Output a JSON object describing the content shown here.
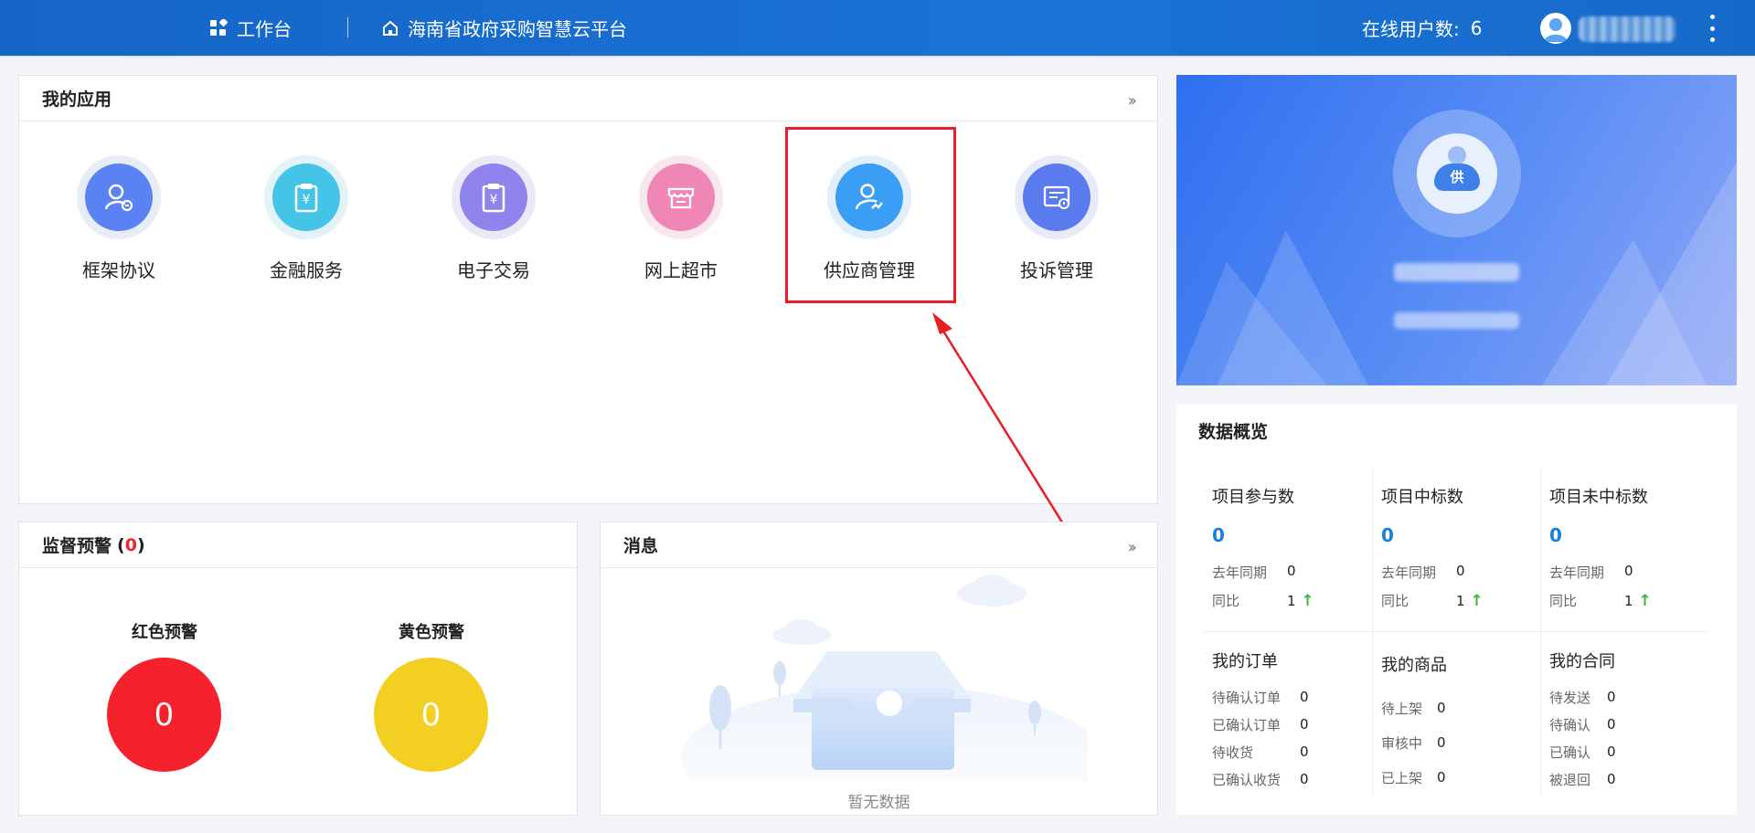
{
  "topbar": {
    "workbench_label": "工作台",
    "platform_label": "海南省政府采购智慧云平台",
    "online_label": "在线用户数:",
    "online_count": "6"
  },
  "my_apps": {
    "title": "我的应用",
    "items": [
      {
        "label": "框架协议",
        "icon": "user-agreement-icon",
        "color": "#5b82f3"
      },
      {
        "label": "金融服务",
        "icon": "clipboard-yen-icon",
        "color": "#44c4e6"
      },
      {
        "label": "电子交易",
        "icon": "clipboard-yen-icon",
        "color": "#8f84ee"
      },
      {
        "label": "网上超市",
        "icon": "store-icon",
        "color": "#ef86b6"
      },
      {
        "label": "供应商管理",
        "icon": "supplier-icon",
        "color": "#3a9ef5"
      },
      {
        "label": "投诉管理",
        "icon": "complaint-icon",
        "color": "#5a7bee"
      }
    ]
  },
  "profile": {
    "badge": "供"
  },
  "supervision": {
    "title": "监督预警",
    "count": "0",
    "red_label": "红色预警",
    "red_value": "0",
    "yellow_label": "黄色预警",
    "yellow_value": "0",
    "red_color": "#f5222d",
    "yellow_color": "#f2cf20"
  },
  "messages": {
    "title": "消息",
    "empty_text": "暂无数据"
  },
  "overview": {
    "title": "数据概览",
    "stats": [
      {
        "title": "项目参与数",
        "value": "0",
        "last_year_label": "去年同期",
        "last_year": "0",
        "yoy_label": "同比",
        "yoy": "1"
      },
      {
        "title": "项目中标数",
        "value": "0",
        "last_year_label": "去年同期",
        "last_year": "0",
        "yoy_label": "同比",
        "yoy": "1"
      },
      {
        "title": "项目未中标数",
        "value": "0",
        "last_year_label": "去年同期",
        "last_year": "0",
        "yoy_label": "同比",
        "yoy": "1"
      }
    ],
    "orders": {
      "title": "我的订单",
      "rows": [
        {
          "label": "待确认订单",
          "value": "0"
        },
        {
          "label": "已确认订单",
          "value": "0"
        },
        {
          "label": "待收货",
          "value": "0"
        },
        {
          "label": "已确认收货",
          "value": "0"
        }
      ]
    },
    "goods": {
      "title": "我的商品",
      "rows": [
        {
          "label": "待上架",
          "value": "0"
        },
        {
          "label": "审核中",
          "value": "0"
        },
        {
          "label": "已上架",
          "value": "0"
        }
      ]
    },
    "contracts": {
      "title": "我的合同",
      "rows": [
        {
          "label": "待发送",
          "value": "0"
        },
        {
          "label": "待确认",
          "value": "0"
        },
        {
          "label": "已确认",
          "value": "0"
        },
        {
          "label": "被退回",
          "value": "0"
        }
      ]
    }
  },
  "accent_color": "#1a73d6"
}
